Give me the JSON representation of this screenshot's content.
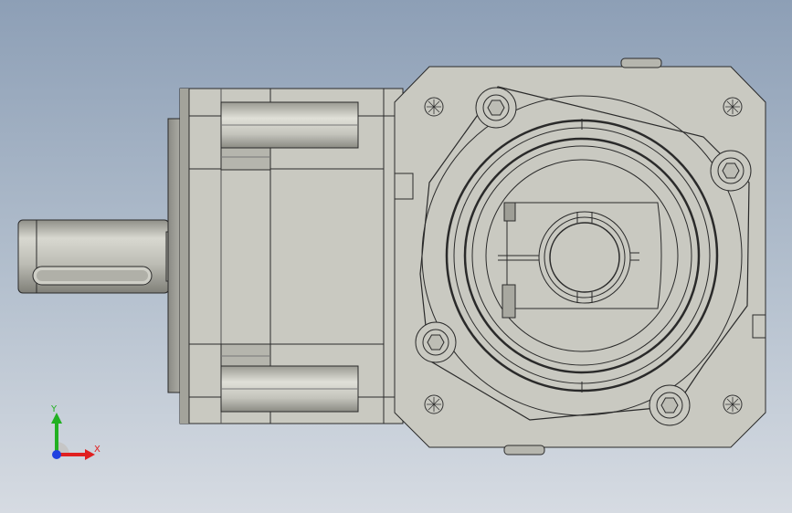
{
  "view": {
    "background_top": "#8d9fb6",
    "background_bottom": "#d6dbe2",
    "part_fill": "#c9c9c1",
    "part_shade": "#a9a9a1",
    "edge_color": "#2a2a2a"
  },
  "triad": {
    "x_label": "X",
    "y_label": "Y",
    "x_color": "#e02020",
    "y_color": "#22b022",
    "z_color": "#2040e0"
  }
}
